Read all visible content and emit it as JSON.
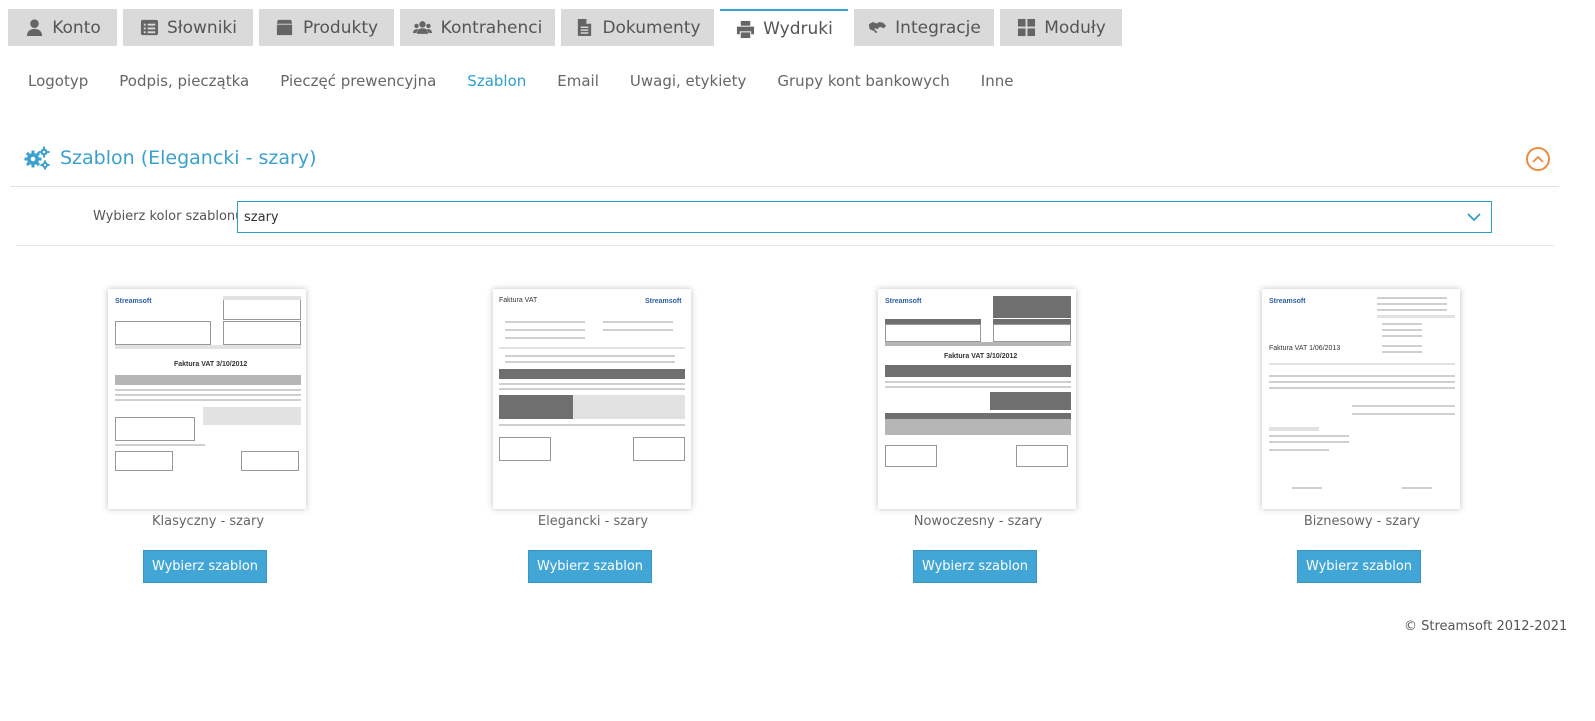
{
  "tabs": [
    {
      "label": "Konto",
      "icon": "user-icon"
    },
    {
      "label": "Słowniki",
      "icon": "list-icon"
    },
    {
      "label": "Produkty",
      "icon": "box-icon"
    },
    {
      "label": "Kontrahenci",
      "icon": "users-icon"
    },
    {
      "label": "Dokumenty",
      "icon": "document-icon"
    },
    {
      "label": "Wydruki",
      "icon": "printer-icon",
      "active": true
    },
    {
      "label": "Integracje",
      "icon": "handshake-icon"
    },
    {
      "label": "Moduły",
      "icon": "grid-icon"
    }
  ],
  "subnav": [
    "Logotyp",
    "Podpis, pieczątka",
    "Pieczęć prewencyjna",
    "Szablon",
    "Email",
    "Uwagi, etykiety",
    "Grupy kont bankowych",
    "Inne"
  ],
  "subnav_active": "Szablon",
  "section": {
    "title": "Szablon (Elegancki - szary)",
    "icon": "gears-icon"
  },
  "color_select": {
    "label": "Wybierz kolor szablonu",
    "value": "szary"
  },
  "templates": [
    {
      "name": "Klasyczny - szary",
      "logo": "Streamsoft",
      "doc_title": "Faktura VAT 3/10/2012",
      "button": "Wybierz szablon"
    },
    {
      "name": "Elegancki - szary",
      "logo": "Streamsoft",
      "doc_title": "Faktura VAT",
      "button": "Wybierz szablon"
    },
    {
      "name": "Nowoczesny - szary",
      "logo": "Streamsoft",
      "doc_title": "Faktura VAT 3/10/2012",
      "button": "Wybierz szablon"
    },
    {
      "name": "Biznesowy - szary",
      "logo": "Streamsoft",
      "doc_title": "Faktura VAT 1/06/2013",
      "button": "Wybierz szablon"
    }
  ],
  "footer": "© Streamsoft 2012-2021",
  "colors": {
    "accent": "#3aa0d0",
    "button": "#41a6d6",
    "collapse": "#f08a3c"
  }
}
